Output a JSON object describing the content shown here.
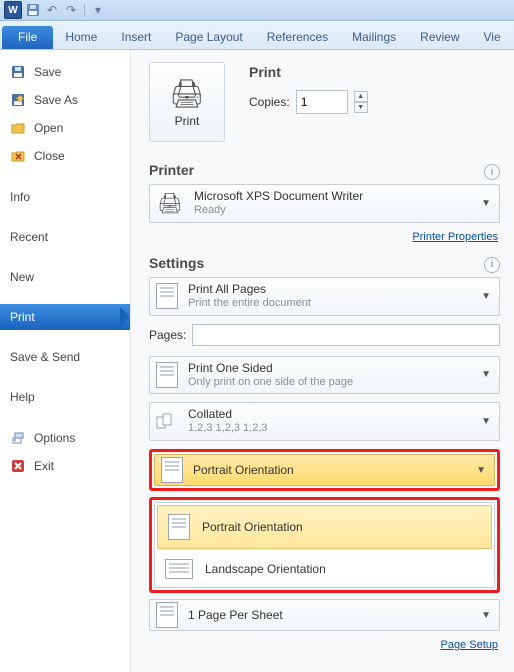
{
  "qat": {
    "app_letter": "W"
  },
  "ribbon": {
    "tabs": [
      "File",
      "Home",
      "Insert",
      "Page Layout",
      "References",
      "Mailings",
      "Review",
      "Vie"
    ]
  },
  "sidebar": {
    "save": "Save",
    "save_as": "Save As",
    "open": "Open",
    "close": "Close",
    "info": "Info",
    "recent": "Recent",
    "new": "New",
    "print": "Print",
    "save_send": "Save & Send",
    "help": "Help",
    "options": "Options",
    "exit": "Exit"
  },
  "print": {
    "heading": "Print",
    "button": "Print",
    "copies_label": "Copies:",
    "copies_value": "1"
  },
  "printer": {
    "heading": "Printer",
    "name": "Microsoft XPS Document Writer",
    "status": "Ready",
    "properties": "Printer Properties"
  },
  "settings": {
    "heading": "Settings",
    "print_all": {
      "title": "Print All Pages",
      "sub": "Print the entire document"
    },
    "pages_label": "Pages:",
    "one_sided": {
      "title": "Print One Sided",
      "sub": "Only print on one side of the page"
    },
    "collated": {
      "title": "Collated",
      "sub": "1,2,3   1,2,3   1,2,3"
    },
    "orientation": {
      "current": "Portrait Orientation",
      "options": [
        "Portrait Orientation",
        "Landscape Orientation"
      ]
    },
    "per_sheet": "1 Page Per Sheet",
    "page_setup": "Page Setup"
  }
}
